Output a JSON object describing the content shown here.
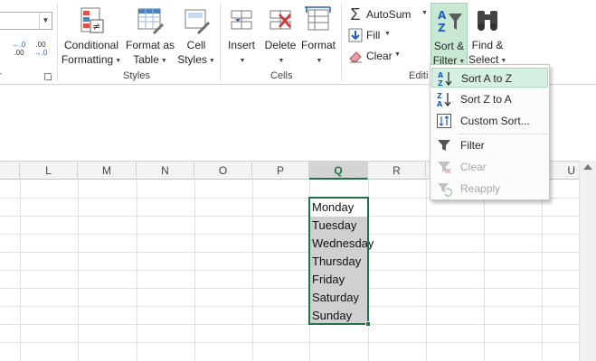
{
  "ribbon": {
    "groups": {
      "styles": "Styles",
      "cells": "Cells",
      "editing": "Editi"
    },
    "left_partial_label": "r",
    "number_format": {
      "increase_decimal": ".0\n.00",
      "decrease_decimal": ".00\n.0"
    },
    "styles": {
      "conditional_formatting": {
        "line1": "Conditional",
        "line2": "Formatting"
      },
      "format_as_table": {
        "line1": "Format as",
        "line2": "Table"
      },
      "cell_styles": {
        "line1": "Cell",
        "line2": "Styles"
      }
    },
    "cells": {
      "insert": "Insert",
      "delete": "Delete",
      "format": "Format"
    },
    "editing": {
      "autosum": "AutoSum",
      "fill": "Fill",
      "clear": "Clear",
      "sort_filter": {
        "line1": "Sort &",
        "line2": "Filter"
      },
      "find_select": {
        "line1": "Find &",
        "line2": "Select"
      }
    }
  },
  "dropdown": {
    "items": [
      {
        "label": "Sort A to Z",
        "state": "hover"
      },
      {
        "label": "Sort Z to A",
        "state": "normal"
      },
      {
        "label": "Custom Sort...",
        "state": "normal"
      },
      {
        "label": "Filter",
        "state": "normal"
      },
      {
        "label": "Clear",
        "state": "disabled"
      },
      {
        "label": "Reapply",
        "state": "disabled"
      }
    ]
  },
  "sheet": {
    "columns": [
      "L",
      "M",
      "N",
      "O",
      "P",
      "Q",
      "R",
      "U"
    ],
    "active_column": "Q",
    "cells": [
      "Monday",
      "Tuesday",
      "Wednesday",
      "Thursday",
      "Friday",
      "Saturday",
      "Sunday"
    ]
  },
  "colors": {
    "excel_green": "#217346",
    "selection_fill": "#d0d0d0",
    "menu_hover": "#d3f0e0"
  }
}
